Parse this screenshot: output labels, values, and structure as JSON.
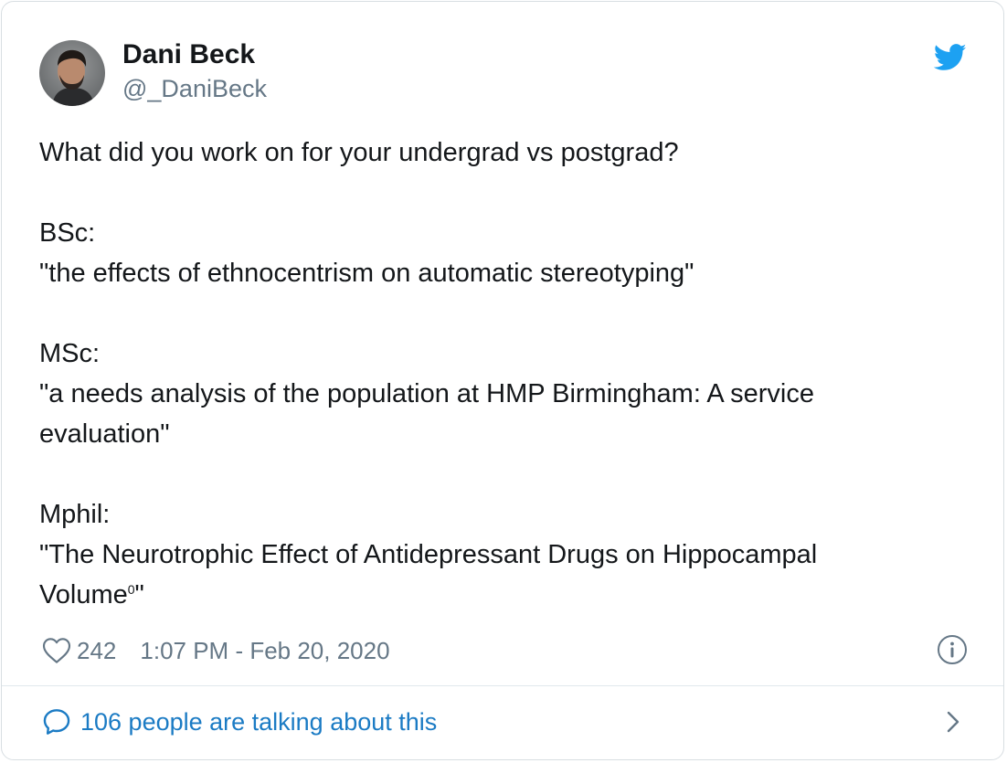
{
  "author": {
    "name": "Dani Beck",
    "handle": "@_DaniBeck",
    "avatar_icon": "profile-photo"
  },
  "brand": {
    "logo_icon": "twitter-bird-icon",
    "accent_color": "#1da1f2",
    "link_color": "#1b7bc4"
  },
  "tweet": {
    "lines": {
      "intro": "What did you work on for your undergrad vs postgrad?",
      "bsc_label": "BSc:",
      "bsc_title": "\"the effects of ethnocentrism on automatic stereotyping\"",
      "msc_label": "MSc:",
      "msc_title_1": "\"a needs analysis of the population at HMP Birmingham: A service",
      "msc_title_2": "evaluation\"",
      "mphil_label": "Mphil:",
      "mphil_title_1": "\"The Neurotrophic Effect of Antidepressant Drugs on Hippocampal",
      "mphil_title_2": "Volume",
      "mphil_sup": "0",
      "mphil_end": "\""
    }
  },
  "meta": {
    "likes": "242",
    "timestamp": "1:07 PM - Feb 20, 2020",
    "heart_icon": "heart-icon",
    "info_icon": "info-icon"
  },
  "footer": {
    "talk_text": "106 people are talking about this",
    "bubble_icon": "speech-bubble-icon",
    "chevron_icon": "chevron-right-icon"
  }
}
